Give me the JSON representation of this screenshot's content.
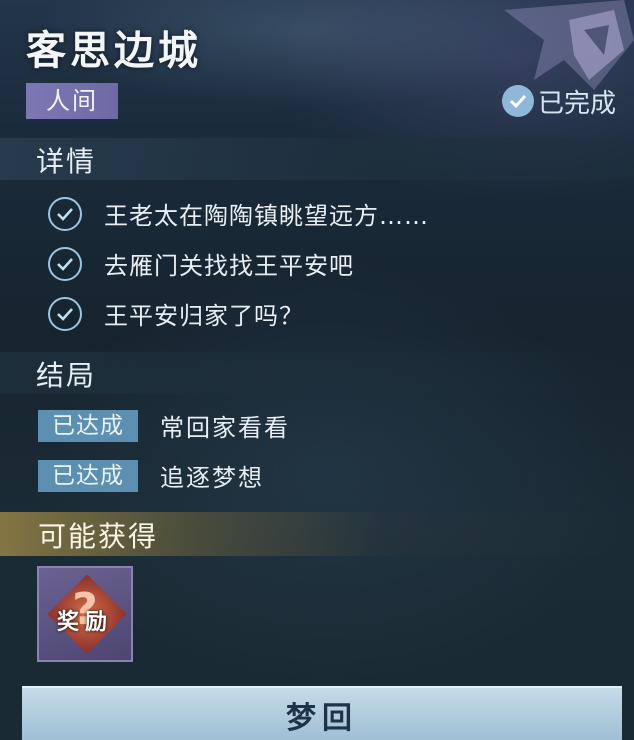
{
  "header": {
    "title": "客思边城",
    "realm_tag": "人间",
    "status": "已完成"
  },
  "details": {
    "title": "详情",
    "items": [
      "王老太在陶陶镇眺望远方……",
      "去雁门关找找王平安吧",
      "王平安归家了吗？"
    ]
  },
  "endings": {
    "title": "结局",
    "items": [
      {
        "badge": "已达成",
        "text": "常回家看看"
      },
      {
        "badge": "已达成",
        "text": "追逐梦想"
      }
    ]
  },
  "rewards": {
    "title": "可能获得",
    "item_label": "奖励",
    "item_mark": "?"
  },
  "action": {
    "label": "梦回"
  },
  "colors": {
    "realm_tag": "#7d78b3",
    "ending_badge": "#5c8fb0",
    "button": "#b4cfe0"
  },
  "icons": [
    "check-circle-icon",
    "wing-decoration-icon",
    "question-mark-icon"
  ]
}
